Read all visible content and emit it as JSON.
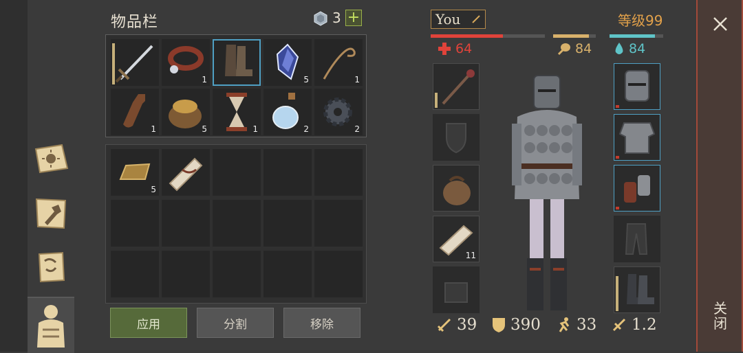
{
  "inventory": {
    "title": "物品栏",
    "gem_count": "3",
    "add_label": "+",
    "items": [
      {
        "icon": "sword-icon",
        "qty": "",
        "durability": 0.9
      },
      {
        "icon": "collar-icon",
        "qty": "1"
      },
      {
        "icon": "boots-icon",
        "qty": "",
        "selected": true
      },
      {
        "icon": "crystal-icon",
        "qty": "5"
      },
      {
        "icon": "rope-icon",
        "qty": "1"
      },
      {
        "icon": "flask-icon",
        "qty": "1"
      },
      {
        "icon": "seed-bag-icon",
        "qty": "5"
      },
      {
        "icon": "hourglass-icon",
        "qty": "1"
      },
      {
        "icon": "potion-icon",
        "qty": "2"
      },
      {
        "icon": "gear-icon",
        "qty": "2"
      },
      {
        "icon": "gold-ingot-icon",
        "qty": "5"
      },
      {
        "icon": "scroll-icon",
        "qty": ""
      }
    ],
    "buttons": {
      "apply": "应用",
      "split": "分割",
      "remove": "移除"
    }
  },
  "character": {
    "name": "You",
    "level": "等级99",
    "health": {
      "value": "64",
      "fraction": 0.63,
      "color": "#e0433a"
    },
    "hunger": {
      "value": "84",
      "fraction": 0.84,
      "color": "#d8b16b"
    },
    "thirst": {
      "value": "84",
      "fraction": 0.84,
      "color": "#5fc4c8"
    },
    "left_slots": [
      {
        "icon": "mace-icon",
        "qty": "",
        "durability": 0.35
      },
      {
        "icon": "shield-slot-icon",
        "qty": ""
      },
      {
        "icon": "bag-icon",
        "qty": ""
      },
      {
        "icon": "bandage-icon",
        "qty": "11"
      },
      {
        "icon": "backpack-slot-icon",
        "qty": ""
      }
    ],
    "right_slots": [
      {
        "icon": "helmet-icon"
      },
      {
        "icon": "chest-armor-icon"
      },
      {
        "icon": "gauntlets-icon"
      },
      {
        "icon": "pants-slot-icon"
      },
      {
        "icon": "boots-armor-icon",
        "durability": 0.8
      }
    ],
    "stats": {
      "attack": "39",
      "armor": "390",
      "speed": "33",
      "weight": "1.2"
    }
  },
  "close": {
    "label": "关闭"
  }
}
